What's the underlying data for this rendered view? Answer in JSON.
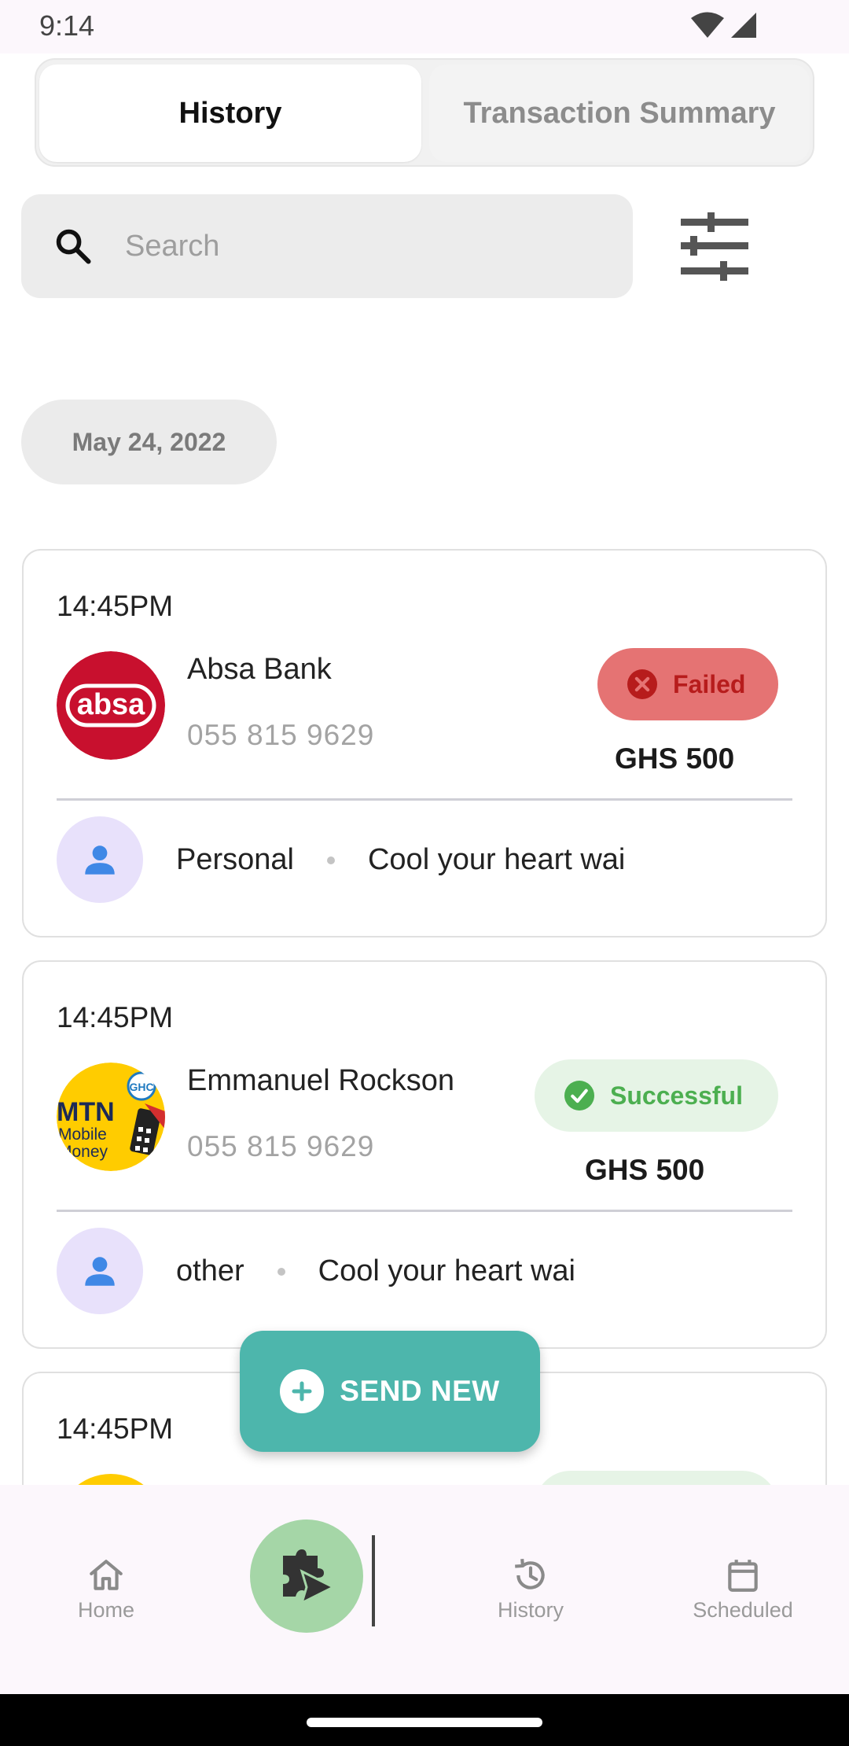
{
  "status_bar": {
    "time": "9:14"
  },
  "tabs": [
    {
      "label": "History",
      "active": true
    },
    {
      "label": "Transaction Summary",
      "active": false
    }
  ],
  "search": {
    "placeholder": "Search",
    "value": ""
  },
  "date_group": "May 24, 2022",
  "transactions": [
    {
      "time": "14:45PM",
      "name": "Absa Bank",
      "phone": "055 815 9629",
      "status": "Failed",
      "amount": "GHS 500",
      "category": "Personal",
      "note": "Cool your heart wai",
      "logo_text": "absa",
      "logo_color": "#c8102e"
    },
    {
      "time": "14:45PM",
      "name": "Emmanuel Rockson",
      "phone": "055 815 9629",
      "status": "Successful",
      "amount": "GHS 500",
      "category": "other",
      "note": "Cool your heart wai",
      "logo_text": [
        "MTN",
        "Mobile",
        "Money",
        "GHC"
      ],
      "logo_color": "#ffcc00"
    },
    {
      "time": "14:45PM"
    }
  ],
  "send_button": {
    "label": "SEND NEW"
  },
  "bottom_nav": {
    "items": [
      {
        "label": "Home",
        "icon": "home-icon"
      },
      {
        "label": "History",
        "icon": "history-icon"
      },
      {
        "label": "Scheduled",
        "icon": "calendar-icon"
      }
    ]
  },
  "colors": {
    "accent": "#4db6ac",
    "failed_bg": "#e57373",
    "failed_fg": "#b71c1c",
    "success_bg": "#e6f4e6",
    "success_fg": "#4caf50",
    "avatar_bg": "#e8e1fb",
    "person_icon": "#3f88e6",
    "nav_fab": "#a5d6a7"
  }
}
